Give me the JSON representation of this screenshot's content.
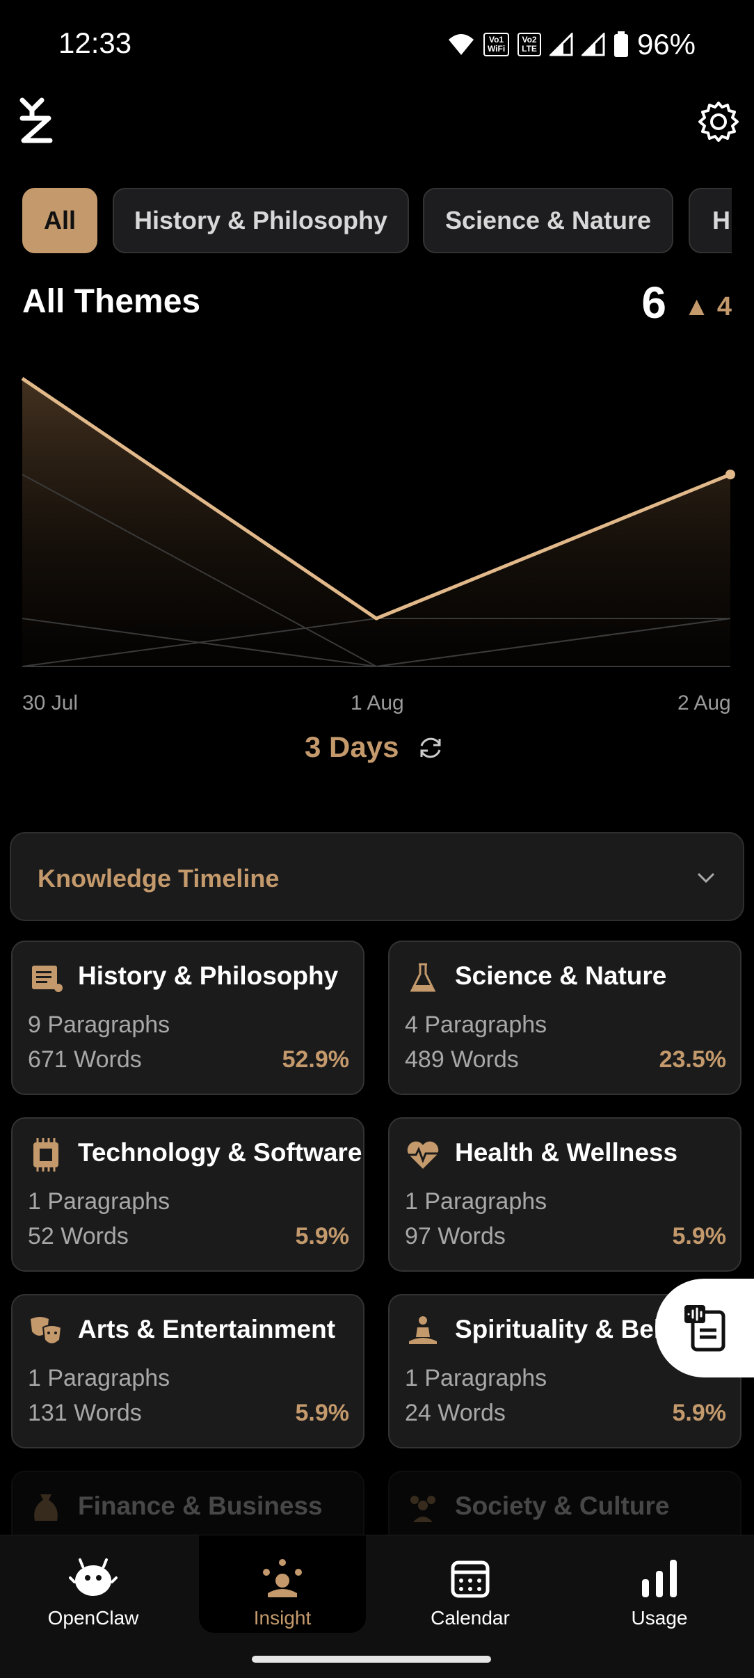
{
  "status": {
    "time": "12:33",
    "battery": "96%",
    "tag1": "Vo 1\nWiFi",
    "tag2": "Vo 2\nLTE"
  },
  "filters": [
    "All",
    "History & Philosophy",
    "Science & Nature",
    "H"
  ],
  "header": {
    "title": "All Themes",
    "count": "6",
    "delta": "▲ 4"
  },
  "chart_data": {
    "type": "area",
    "x": [
      "30 Jul",
      "1 Aug",
      "2 Aug"
    ],
    "series": [
      {
        "values": [
          6,
          1,
          4
        ]
      },
      {
        "values": [
          4,
          0,
          1
        ]
      },
      {
        "values": [
          0,
          1,
          1
        ]
      },
      {
        "values": [
          1,
          0,
          1
        ]
      },
      {
        "values": [
          0,
          0,
          0
        ]
      }
    ],
    "ylim": [
      0,
      6
    ],
    "colors": {
      "main": "#e2b98a",
      "secondary": "#3a3a3a"
    }
  },
  "range": {
    "label": "3 Days"
  },
  "timeline": {
    "label": "Knowledge Timeline"
  },
  "cards": [
    {
      "title": "History & Philosophy",
      "paragraphs": "9 Paragraphs",
      "words": "671 Words",
      "percent": "52.9%",
      "icon": "scroll-icon"
    },
    {
      "title": "Science & Nature",
      "paragraphs": "4 Paragraphs",
      "words": "489 Words",
      "percent": "23.5%",
      "icon": "flask-icon"
    },
    {
      "title": "Technology & Software",
      "paragraphs": "1 Paragraphs",
      "words": "52 Words",
      "percent": "5.9%",
      "icon": "chip-icon"
    },
    {
      "title": "Health & Wellness",
      "paragraphs": "1 Paragraphs",
      "words": "97 Words",
      "percent": "5.9%",
      "icon": "heartbeat-icon"
    },
    {
      "title": "Arts & Entertainment",
      "paragraphs": "1 Paragraphs",
      "words": "131 Words",
      "percent": "5.9%",
      "icon": "theater-masks-icon"
    },
    {
      "title": "Spirituality & Beli",
      "paragraphs": "1 Paragraphs",
      "words": "24 Words",
      "percent": "5.9%",
      "icon": "meditation-icon"
    },
    {
      "title": "Finance & Business",
      "icon": "money-bag-icon"
    },
    {
      "title": "Society & Culture",
      "icon": "people-icon"
    }
  ],
  "nav": [
    "OpenClaw",
    "Insight",
    "Calendar",
    "Usage"
  ],
  "theme": {
    "accent": "#c49a6c",
    "card": "#1b1b1c",
    "bg": "#000000"
  }
}
